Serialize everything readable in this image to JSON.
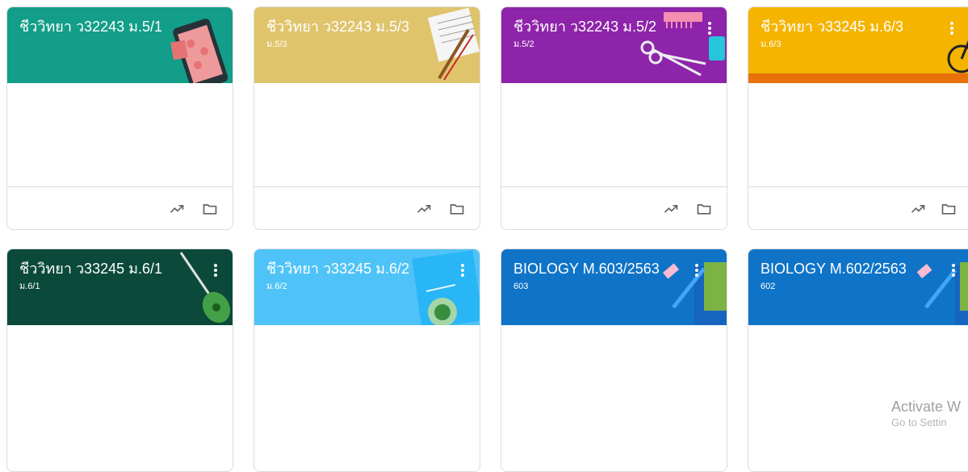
{
  "colors": {
    "teal": "#129e88",
    "gold": "#e0c46c",
    "purple": "#8e24aa",
    "amber": "#f4b400",
    "dark_green": "#0b4a3a",
    "sky_blue": "#4fc3f7",
    "blue": "#0f74c7"
  },
  "classes": [
    {
      "title": "ชีววิทยา ว32243 ม.5/1",
      "section": "",
      "theme": "teal",
      "menu_visible": false,
      "illustration": "tablet-icon",
      "footer_visible": true
    },
    {
      "title": "ชีววิทยา ว32243 ม.5/3",
      "section": "ม.5/3",
      "theme": "gold",
      "menu_visible": false,
      "illustration": "sheet-music-icon",
      "footer_visible": true
    },
    {
      "title": "ชีววิทยา ว32243 ม.5/2",
      "section": "ม.5/2",
      "theme": "purple",
      "menu_visible": true,
      "illustration": "scissors-comb-icon",
      "footer_visible": true
    },
    {
      "title": "ชีววิทยา ว33245 ม.6/3",
      "section": "ม.6/3",
      "theme": "amber",
      "menu_visible": true,
      "illustration": "bicycle-icon",
      "footer_visible": true
    },
    {
      "title": "ชีววิทยา ว33245 ม.6/1",
      "section": "ม.6/1",
      "theme": "dark_green",
      "menu_visible": true,
      "illustration": "guitar-icon",
      "footer_visible": false
    },
    {
      "title": "ชีววิทยา ว33245 ม.6/2",
      "section": "ม.6/2",
      "theme": "sky_blue",
      "menu_visible": true,
      "illustration": "plate-icon",
      "footer_visible": false
    },
    {
      "title": "BIOLOGY M.603/2563",
      "section": "603",
      "theme": "blue",
      "menu_visible": true,
      "illustration": "pencil-icon",
      "footer_visible": false
    },
    {
      "title": "BIOLOGY M.602/2563",
      "section": "602",
      "theme": "blue",
      "menu_visible": true,
      "illustration": "pencil-icon",
      "footer_visible": false
    }
  ],
  "icons": {
    "more": "more-vert-icon",
    "trend": "trending-up-icon",
    "folder": "folder-icon"
  },
  "watermark": {
    "line1": "Activate W",
    "line2": "Go to Settin"
  }
}
